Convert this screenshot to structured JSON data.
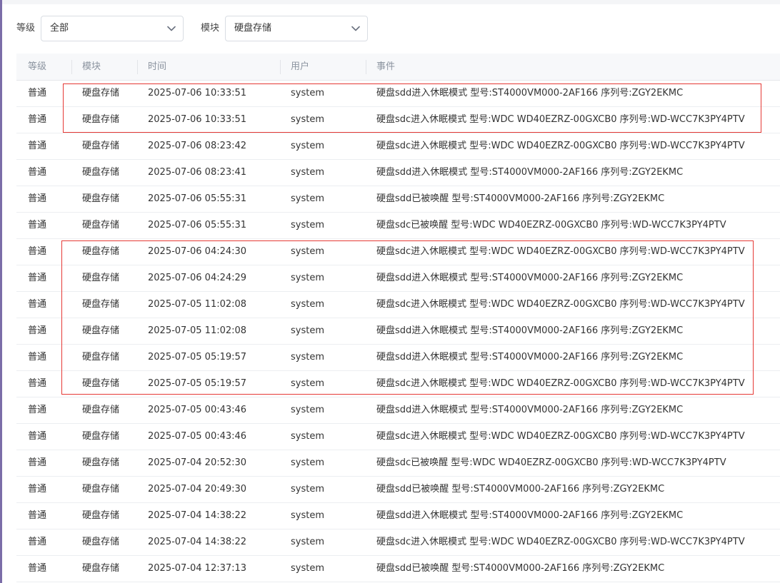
{
  "filters": {
    "level_label": "等级",
    "level_value": "全部",
    "module_label": "模块",
    "module_value": "硬盘存储"
  },
  "table": {
    "headers": [
      "等级",
      "模块",
      "时间",
      "用户",
      "事件"
    ],
    "rows": [
      {
        "level": "普通",
        "module": "硬盘存储",
        "time": "2025-07-06 10:33:51",
        "user": "system",
        "event": "硬盘sdd进入休眠模式 型号:ST4000VM000-2AF166 序列号:ZGY2EKMC"
      },
      {
        "level": "普通",
        "module": "硬盘存储",
        "time": "2025-07-06 10:33:51",
        "user": "system",
        "event": "硬盘sdc进入休眠模式 型号:WDC WD40EZRZ-00GXCB0 序列号:WD-WCC7K3PY4PTV"
      },
      {
        "level": "普通",
        "module": "硬盘存储",
        "time": "2025-07-06 08:23:42",
        "user": "system",
        "event": "硬盘sdc进入休眠模式 型号:WDC WD40EZRZ-00GXCB0 序列号:WD-WCC7K3PY4PTV"
      },
      {
        "level": "普通",
        "module": "硬盘存储",
        "time": "2025-07-06 08:23:41",
        "user": "system",
        "event": "硬盘sdd进入休眠模式 型号:ST4000VM000-2AF166 序列号:ZGY2EKMC"
      },
      {
        "level": "普通",
        "module": "硬盘存储",
        "time": "2025-07-06 05:55:31",
        "user": "system",
        "event": "硬盘sdd已被唤醒 型号:ST4000VM000-2AF166 序列号:ZGY2EKMC"
      },
      {
        "level": "普通",
        "module": "硬盘存储",
        "time": "2025-07-06 05:55:31",
        "user": "system",
        "event": "硬盘sdc已被唤醒 型号:WDC WD40EZRZ-00GXCB0 序列号:WD-WCC7K3PY4PTV"
      },
      {
        "level": "普通",
        "module": "硬盘存储",
        "time": "2025-07-06 04:24:30",
        "user": "system",
        "event": "硬盘sdc进入休眠模式 型号:WDC WD40EZRZ-00GXCB0 序列号:WD-WCC7K3PY4PTV"
      },
      {
        "level": "普通",
        "module": "硬盘存储",
        "time": "2025-07-06 04:24:29",
        "user": "system",
        "event": "硬盘sdd进入休眠模式 型号:ST4000VM000-2AF166 序列号:ZGY2EKMC"
      },
      {
        "level": "普通",
        "module": "硬盘存储",
        "time": "2025-07-05 11:02:08",
        "user": "system",
        "event": "硬盘sdc进入休眠模式 型号:WDC WD40EZRZ-00GXCB0 序列号:WD-WCC7K3PY4PTV"
      },
      {
        "level": "普通",
        "module": "硬盘存储",
        "time": "2025-07-05 11:02:08",
        "user": "system",
        "event": "硬盘sdd进入休眠模式 型号:ST4000VM000-2AF166 序列号:ZGY2EKMC"
      },
      {
        "level": "普通",
        "module": "硬盘存储",
        "time": "2025-07-05 05:19:57",
        "user": "system",
        "event": "硬盘sdd进入休眠模式 型号:ST4000VM000-2AF166 序列号:ZGY2EKMC"
      },
      {
        "level": "普通",
        "module": "硬盘存储",
        "time": "2025-07-05 05:19:57",
        "user": "system",
        "event": "硬盘sdc进入休眠模式 型号:WDC WD40EZRZ-00GXCB0 序列号:WD-WCC7K3PY4PTV"
      },
      {
        "level": "普通",
        "module": "硬盘存储",
        "time": "2025-07-05 00:43:46",
        "user": "system",
        "event": "硬盘sdd进入休眠模式 型号:ST4000VM000-2AF166 序列号:ZGY2EKMC"
      },
      {
        "level": "普通",
        "module": "硬盘存储",
        "time": "2025-07-05 00:43:46",
        "user": "system",
        "event": "硬盘sdc进入休眠模式 型号:WDC WD40EZRZ-00GXCB0 序列号:WD-WCC7K3PY4PTV"
      },
      {
        "level": "普通",
        "module": "硬盘存储",
        "time": "2025-07-04 20:52:30",
        "user": "system",
        "event": "硬盘sdc已被唤醒 型号:WDC WD40EZRZ-00GXCB0 序列号:WD-WCC7K3PY4PTV"
      },
      {
        "level": "普通",
        "module": "硬盘存储",
        "time": "2025-07-04 20:49:30",
        "user": "system",
        "event": "硬盘sdd已被唤醒 型号:ST4000VM000-2AF166 序列号:ZGY2EKMC"
      },
      {
        "level": "普通",
        "module": "硬盘存储",
        "time": "2025-07-04 14:38:22",
        "user": "system",
        "event": "硬盘sdd进入休眠模式 型号:ST4000VM000-2AF166 序列号:ZGY2EKMC"
      },
      {
        "level": "普通",
        "module": "硬盘存储",
        "time": "2025-07-04 14:38:22",
        "user": "system",
        "event": "硬盘sdc进入休眠模式 型号:WDC WD40EZRZ-00GXCB0 序列号:WD-WCC7K3PY4PTV"
      },
      {
        "level": "普通",
        "module": "硬盘存储",
        "time": "2025-07-04 12:37:13",
        "user": "system",
        "event": "硬盘sdd已被唤醒 型号:ST4000VM000-2AF166 序列号:ZGY2EKMC"
      }
    ]
  },
  "colors": {
    "highlight_box": "#e53935",
    "header_text": "#8c94a0",
    "header_bg": "#f7f8fa"
  },
  "icons": {
    "select_chevron": "chevron-down-icon"
  }
}
